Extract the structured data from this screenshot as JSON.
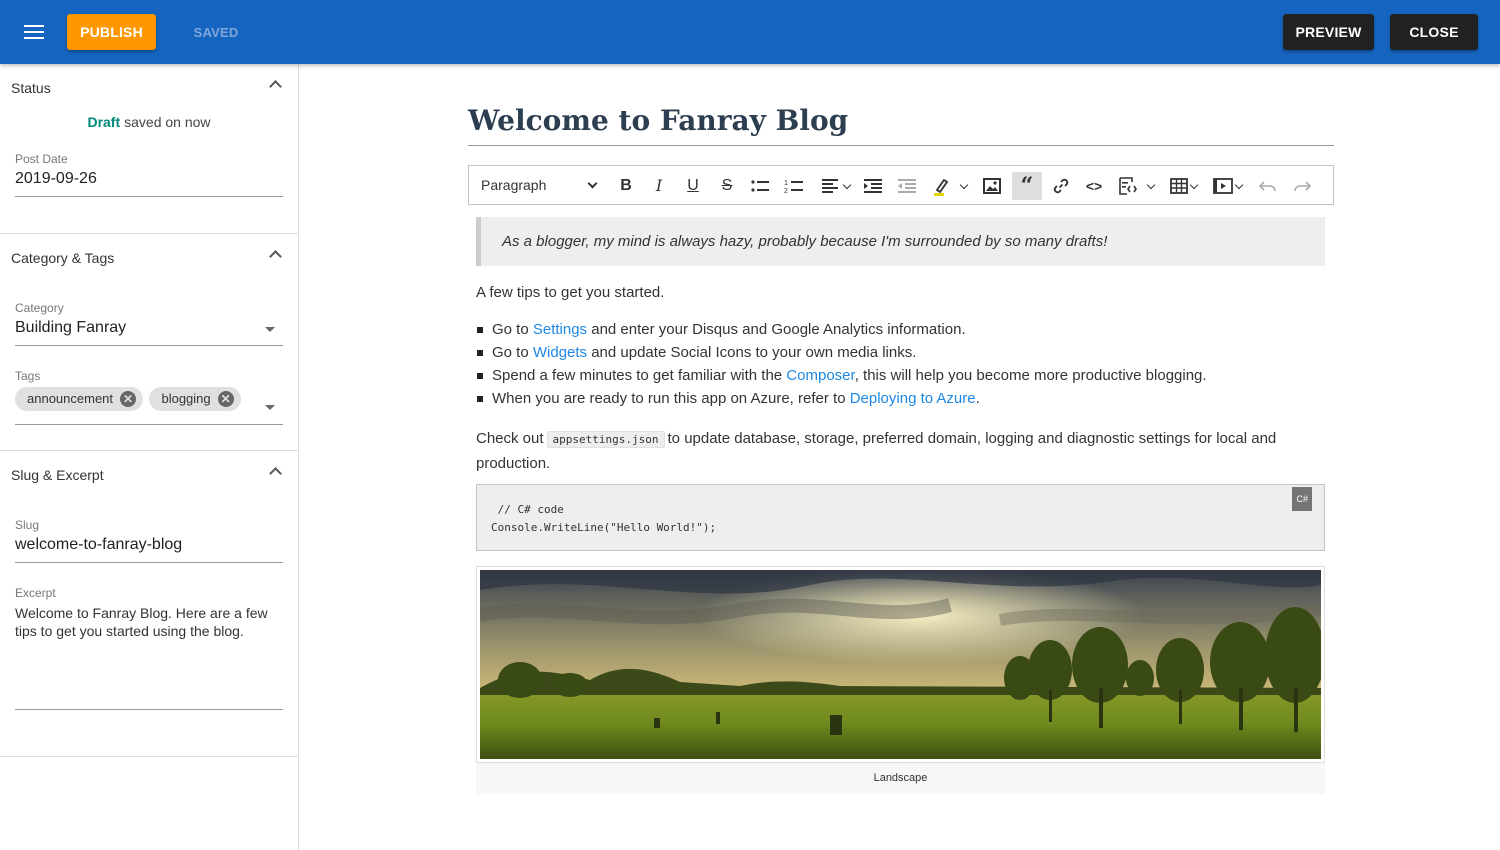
{
  "topbar": {
    "publish_label": "PUBLISH",
    "saved_label": "SAVED",
    "preview_label": "PREVIEW",
    "close_label": "CLOSE",
    "bar_color": "#1565c0",
    "publish_color": "#ff9800"
  },
  "sidebar": {
    "status": {
      "title": "Status",
      "draft_word": "Draft",
      "saved_text": "saved on now",
      "post_date_label": "Post Date",
      "post_date_value": "2019-09-26"
    },
    "category_tags": {
      "title": "Category & Tags",
      "category_label": "Category",
      "category_value": "Building Fanray",
      "tags_label": "Tags",
      "tags": [
        "announcement",
        "blogging"
      ]
    },
    "slug_excerpt": {
      "title": "Slug & Excerpt",
      "slug_label": "Slug",
      "slug_value": "welcome-to-fanray-blog",
      "excerpt_label": "Excerpt",
      "excerpt_value": "Welcome to Fanray Blog. Here are a few tips to get you started using the blog."
    }
  },
  "editor": {
    "title": "Welcome to Fanray Blog",
    "toolbar": {
      "heading_select": "Paragraph",
      "icons": [
        "bold-icon",
        "italic-icon",
        "underline-icon",
        "strikethrough-icon",
        "bulleted-list-icon",
        "numbered-list-icon",
        "align-icon",
        "indent-icon",
        "outdent-icon",
        "highlight-icon",
        "image-icon",
        "quote-icon",
        "link-icon",
        "code-icon",
        "code-block-icon",
        "table-icon",
        "media-icon",
        "undo-icon",
        "redo-icon"
      ]
    },
    "blockquote": "As a blogger, my mind is always hazy, probably because I'm surrounded by so many drafts!",
    "intro": "A few tips to get you started.",
    "tips": [
      {
        "before": "Go to ",
        "link": "Settings",
        "after": " and enter your Disqus and Google Analytics information."
      },
      {
        "before": "Go to ",
        "link": "Widgets",
        "after": " and update Social Icons to your own media links."
      },
      {
        "before": "Spend a few minutes to get familiar with the ",
        "link": "Composer",
        "after": ", this will help you become more productive blogging."
      },
      {
        "before": "When you are ready to run this app on Azure, refer to ",
        "link": "Deploying to Azure",
        "after": "."
      }
    ],
    "checkout": {
      "before": "Check out",
      "code": "appsettings.json",
      "after": "to update database, storage, preferred domain, logging and diagnostic settings for local and production."
    },
    "code_block": {
      "language": "C#",
      "line1": " // C# code",
      "line2": "Console.WriteLine(\"Hello World!\");"
    },
    "image_caption": "Landscape",
    "link_color": "#1e88e5"
  }
}
